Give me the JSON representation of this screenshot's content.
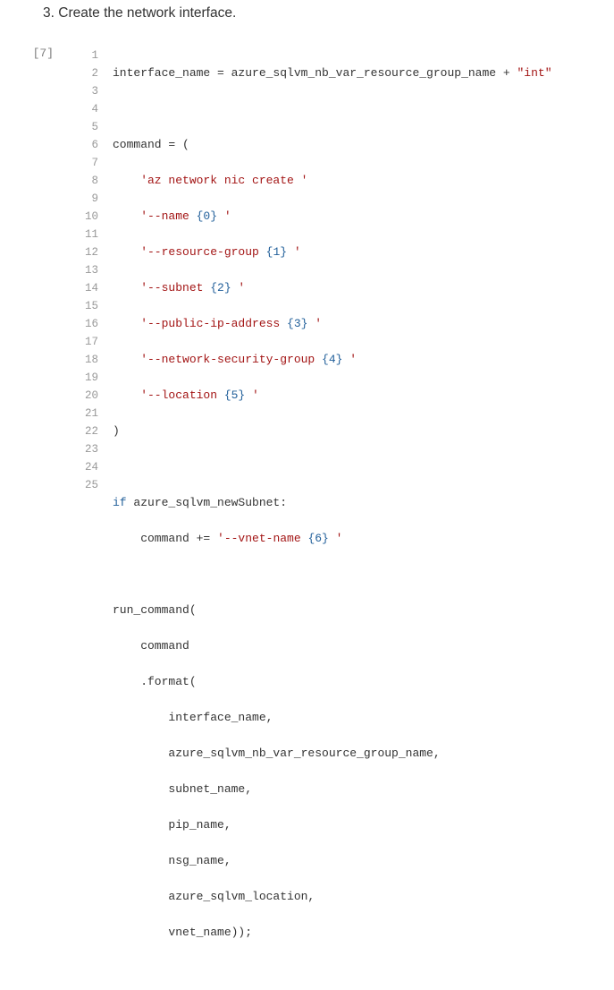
{
  "step": {
    "number": "3.",
    "text": "Create the network interface."
  },
  "cell": {
    "prompt": "[7]",
    "line_count": 25,
    "code": {
      "l1a": "interface_name = azure_sqlvm_nb_var_resource_group_name + ",
      "l1b": "\"int\"",
      "l3": "command = (",
      "l4": "    'az network nic create '",
      "l5a": "    '--name ",
      "l5b": "{0}",
      "l5c": " '",
      "l6a": "    '--resource-group ",
      "l6b": "{1}",
      "l6c": " '",
      "l7a": "    '--subnet ",
      "l7b": "{2}",
      "l7c": " '",
      "l8a": "    '--public-ip-address ",
      "l8b": "{3}",
      "l8c": " '",
      "l9a": "    '--network-security-group ",
      "l9b": "{4}",
      "l9c": " '",
      "l10a": "    '--location ",
      "l10b": "{5}",
      "l10c": " '",
      "l11": ")",
      "l13a": "if",
      "l13b": " azure_sqlvm_newSubnet:",
      "l14a": "    command += ",
      "l14b": "'--vnet-name ",
      "l14c": "{6}",
      "l14d": " '",
      "l16": "run_command(",
      "l17": "    command",
      "l18": "    .format(",
      "l19": "        interface_name,",
      "l20": "        azure_sqlvm_nb_var_resource_group_name,",
      "l21": "        subnet_name,",
      "l22": "        pip_name,",
      "l23": "        nsg_name,",
      "l24": "        azure_sqlvm_location,",
      "l25": "        vnet_name));"
    }
  }
}
